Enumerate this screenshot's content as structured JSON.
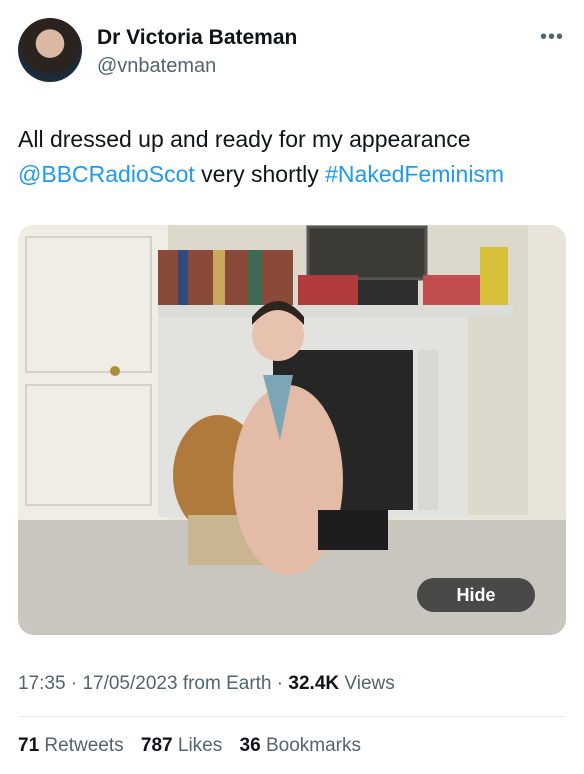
{
  "author": {
    "name": "Dr Victoria Bateman",
    "handle": "@vnbateman"
  },
  "tweet": {
    "text_line1": "All dressed up and ready for my appearance",
    "mention": "@BBCRadioScot",
    "text_middle": " very shortly ",
    "hashtag": "#NakedFeminism"
  },
  "media": {
    "hide_label": "Hide"
  },
  "meta": {
    "time": "17:35",
    "date": "17/05/2023",
    "source": "from Earth",
    "views_count": "32.4K",
    "views_label": "Views",
    "sep": "·"
  },
  "stats": {
    "retweets_count": "71",
    "retweets_label": "Retweets",
    "likes_count": "787",
    "likes_label": "Likes",
    "bookmarks_count": "36",
    "bookmarks_label": "Bookmarks"
  },
  "icons": {
    "more": "more-options-icon"
  }
}
